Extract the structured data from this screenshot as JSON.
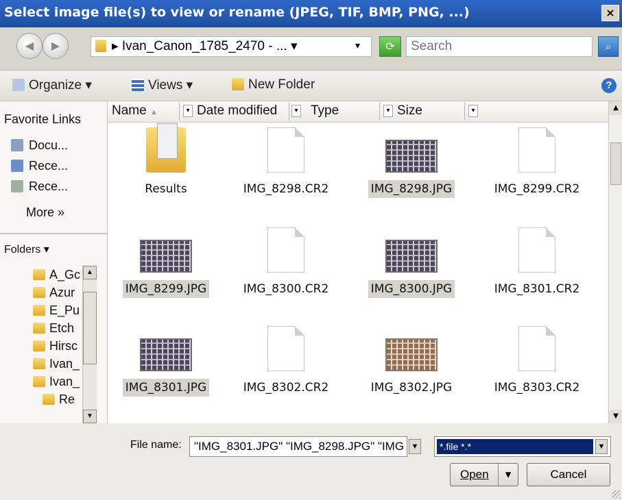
{
  "window": {
    "title": "Select image file(s) to view or rename (JPEG, TIF, BMP, PNG, ...)",
    "close_glyph": "×"
  },
  "address_bar": {
    "back_glyph": "◀",
    "forward_glyph": "▶",
    "path": "▸ Ivan_Canon_1785_2470 - ... ▾",
    "dropdown_glyph": "▾",
    "refresh_icon": "refresh-icon",
    "search_placeholder": "Search",
    "search_glyph": "⌕"
  },
  "toolbar": {
    "organize_label": "Organize ▾",
    "views_label": "Views ▾",
    "new_folder_label": "New Folder",
    "help_glyph": "?"
  },
  "nav_pane": {
    "favorite_links_title": "Favorite Links",
    "links": [
      {
        "label": "Docu...",
        "icon": "documents-icon"
      },
      {
        "label": "Rece...",
        "icon": "recent-places-icon"
      },
      {
        "label": "Rece...",
        "icon": "recently-changed-icon"
      }
    ],
    "more_label": "More  »",
    "folders_title": "Folders  ▾",
    "tree": [
      "A_Gc",
      "Azur",
      "E_Pu",
      "Etch",
      "Hirsc",
      "Ivan_",
      "Ivan_",
      "Re"
    ]
  },
  "columns": {
    "name": "Name",
    "date_modified": "Date modified",
    "type": "Type",
    "size": "Size",
    "sort_glyph": "▲"
  },
  "files": [
    {
      "name": "Results",
      "kind": "folder",
      "selected": false
    },
    {
      "name": "IMG_8298.CR2",
      "kind": "doc",
      "selected": false
    },
    {
      "name": "IMG_8298.JPG",
      "kind": "photo",
      "selected": true
    },
    {
      "name": "IMG_8299.CR2",
      "kind": "doc",
      "selected": false
    },
    {
      "name": "IMG_8299.JPG",
      "kind": "photo",
      "selected": true
    },
    {
      "name": "IMG_8300.CR2",
      "kind": "doc",
      "selected": false
    },
    {
      "name": "IMG_8300.JPG",
      "kind": "photo",
      "selected": true
    },
    {
      "name": "IMG_8301.CR2",
      "kind": "doc",
      "selected": false
    },
    {
      "name": "IMG_8301.JPG",
      "kind": "photo",
      "selected": true
    },
    {
      "name": "IMG_8302.CR2",
      "kind": "doc",
      "selected": false
    },
    {
      "name": "IMG_8302.JPG",
      "kind": "photo-warm",
      "selected": false
    },
    {
      "name": "IMG_8303.CR2",
      "kind": "doc",
      "selected": false
    }
  ],
  "bottom": {
    "file_name_label": "File name:",
    "file_name_value": "\"IMG_8301.JPG\" \"IMG_8298.JPG\" \"IMG",
    "filter_value": "*.file *.*",
    "open_label": "Open",
    "open_split_glyph": "▾",
    "cancel_label": "Cancel"
  }
}
